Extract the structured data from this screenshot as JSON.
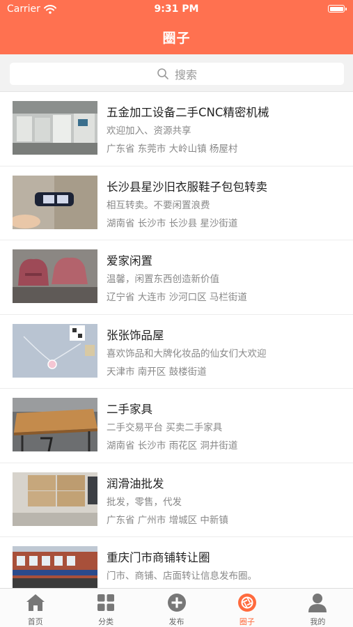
{
  "status_bar": {
    "carrier": "Carrier",
    "time": "9:31 PM"
  },
  "header": {
    "title": "圈子"
  },
  "search": {
    "placeholder": "搜索"
  },
  "groups": [
    {
      "title": "五金加工设备二手CNC精密机械",
      "desc": "欢迎加入、资源共享",
      "location": "广东省 东莞市 大岭山镇 杨屋村"
    },
    {
      "title": "长沙县星沙旧衣服鞋子包包转卖",
      "desc": "相互转卖。不要闲置浪费",
      "location": "湖南省 长沙市 长沙县 星沙街道"
    },
    {
      "title": "爱家闲置",
      "desc": "温馨，闲置东西创造新价值",
      "location": "辽宁省 大连市 沙河口区 马栏街道"
    },
    {
      "title": "张张饰品屋",
      "desc": "喜欢饰品和大牌化妆品的仙女们大欢迎",
      "location": "天津市 南开区 鼓楼街道"
    },
    {
      "title": "二手家具",
      "desc": "二手交易平台 买卖二手家具",
      "location": "湖南省 长沙市 雨花区 洞井街道"
    },
    {
      "title": "润滑油批发",
      "desc": "批发，零售，代发",
      "location": "广东省 广州市 增城区 中新镇"
    },
    {
      "title": "重庆门市商铺转让圈",
      "desc": "门市、商铺、店面转让信息发布圈。",
      "location": ""
    }
  ],
  "tabbar": {
    "items": [
      {
        "label": "首页",
        "icon": "home-icon"
      },
      {
        "label": "分类",
        "icon": "grid-icon"
      },
      {
        "label": "发布",
        "icon": "plus-circle-icon"
      },
      {
        "label": "圈子",
        "icon": "aperture-icon"
      },
      {
        "label": "我的",
        "icon": "person-icon"
      }
    ],
    "active": "圈子",
    "active_color": "#ff6a3d"
  },
  "colors": {
    "header": "#ff7150",
    "inactive_tab": "#666666"
  }
}
